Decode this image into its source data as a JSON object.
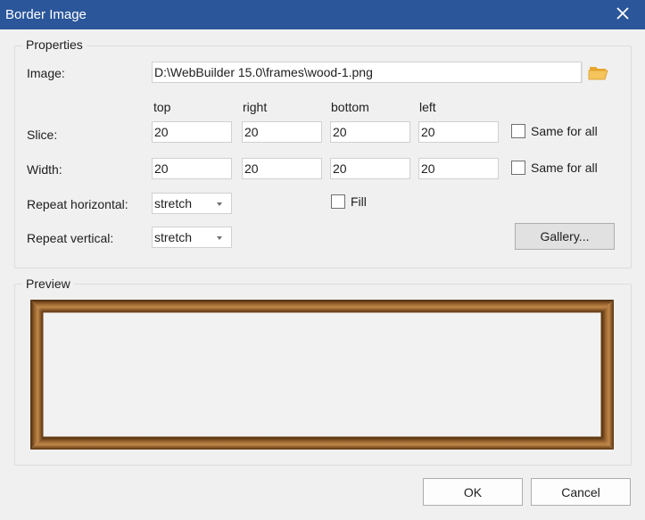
{
  "window": {
    "title": "Border Image"
  },
  "properties": {
    "legend": "Properties",
    "image_label": "Image:",
    "image_path": "D:\\WebBuilder 15.0\\frames\\wood-1.png",
    "columns": [
      "top",
      "right",
      "bottom",
      "left"
    ],
    "slice_label": "Slice:",
    "slice_values": [
      "20",
      "20",
      "20",
      "20"
    ],
    "width_label": "Width:",
    "width_values": [
      "20",
      "20",
      "20",
      "20"
    ],
    "same_for_all_label": "Same for all",
    "repeat_horizontal_label": "Repeat horizontal:",
    "repeat_horizontal_value": "stretch",
    "repeat_vertical_label": "Repeat vertical:",
    "repeat_vertical_value": "stretch",
    "fill_label": "Fill",
    "gallery_label": "Gallery..."
  },
  "preview": {
    "legend": "Preview"
  },
  "buttons": {
    "ok": "OK",
    "cancel": "Cancel"
  },
  "colors": {
    "title_bar": "#2b579a",
    "wood_dark": "#5a3210",
    "wood_light": "#b57a3c"
  },
  "icons": {
    "close": "close-icon",
    "browse": "folder-open-icon"
  }
}
